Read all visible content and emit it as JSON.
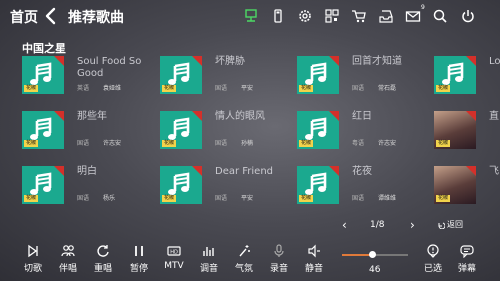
{
  "header": {
    "home": "首页",
    "title": "推荐歌曲",
    "mail_count": "9",
    "icons": [
      "network-icon",
      "usb-icon",
      "settings-icon",
      "qr-code-icon",
      "cart-icon",
      "inbox-icon",
      "mail-icon",
      "search-icon",
      "power-icon"
    ]
  },
  "section_title": "中国之星",
  "song_tag": "花椒",
  "songs": [
    {
      "name": "Soul Food So Good",
      "lang": "英语",
      "singer": "袁娅维"
    },
    {
      "name": "坏脾胁",
      "lang": "国语",
      "singer": "平安"
    },
    {
      "name": "回首才知道",
      "lang": "国语",
      "singer": "常石磊"
    },
    {
      "name": "Lo",
      "lang": "",
      "singer": ""
    },
    {
      "name": "那些年",
      "lang": "国语",
      "singer": "许志安"
    },
    {
      "name": "情人的眼风",
      "lang": "国语",
      "singer": "孙楠"
    },
    {
      "name": "红日",
      "lang": "粤语",
      "singer": "许志安"
    },
    {
      "name": "直",
      "lang": "",
      "singer": ""
    },
    {
      "name": "明白",
      "lang": "国语",
      "singer": "杨乐"
    },
    {
      "name": "Dear Friend",
      "lang": "国语",
      "singer": "平安"
    },
    {
      "name": "花夜",
      "lang": "国语",
      "singer": "谭维维"
    },
    {
      "name": "飞",
      "lang": "",
      "singer": ""
    }
  ],
  "pager": {
    "text": "1/8",
    "prev": "‹",
    "next": "›"
  },
  "back_label": "返回",
  "controls": [
    {
      "label": "切歌",
      "icon": "skip-icon"
    },
    {
      "label": "伴唱",
      "icon": "duet-icon"
    },
    {
      "label": "重唱",
      "icon": "replay-icon"
    },
    {
      "label": "暂停",
      "icon": "pause-icon"
    },
    {
      "label": "MTV",
      "icon": "hd-icon"
    },
    {
      "label": "调音",
      "icon": "equalizer-icon"
    },
    {
      "label": "气氛",
      "icon": "atmosphere-icon"
    },
    {
      "label": "录音",
      "icon": "microphone-icon"
    },
    {
      "label": "静音",
      "icon": "mute-icon"
    },
    {
      "label": "已选",
      "icon": "selected-icon"
    },
    {
      "label": "弹幕",
      "icon": "bullet-comment-icon"
    }
  ],
  "volume": {
    "value": "46",
    "level": 0.46
  },
  "colors": {
    "thumb": "#1ba98f",
    "tag": "#f2d34b",
    "corner": "#d4302a",
    "accent": "#e07a3a",
    "network": "#4cd964"
  }
}
